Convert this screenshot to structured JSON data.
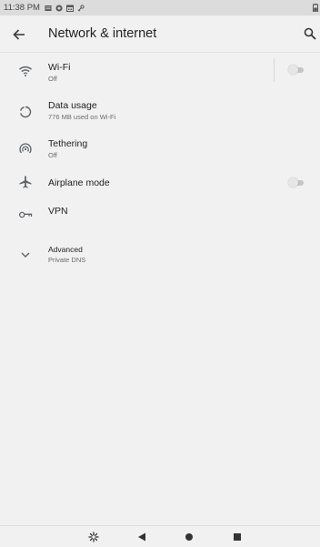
{
  "status_bar": {
    "time": "11:38 PM",
    "icons": [
      "message-icon",
      "shield-icon",
      "calendar-icon",
      "key-icon"
    ],
    "battery_icon": "battery-icon"
  },
  "app_bar": {
    "title": "Network & internet",
    "back_icon": "back-arrow-icon",
    "search_icon": "search-icon"
  },
  "items": [
    {
      "id": "wifi",
      "icon": "wifi-icon",
      "title": "Wi-Fi",
      "subtitle": "Off",
      "toggle": "off"
    },
    {
      "id": "data-usage",
      "icon": "data-usage-icon",
      "title": "Data usage",
      "subtitle": "776 MB used on Wi-Fi"
    },
    {
      "id": "tethering",
      "icon": "hotspot-icon",
      "title": "Tethering",
      "subtitle": "Off"
    },
    {
      "id": "airplane-mode",
      "icon": "airplane-icon",
      "title": "Airplane mode",
      "toggle": "off"
    },
    {
      "id": "vpn",
      "icon": "vpn-key-icon",
      "title": "VPN"
    },
    {
      "id": "advanced",
      "icon": "chevron-down-icon",
      "title": "Advanced",
      "subtitle": "Private DNS"
    }
  ],
  "nav_bar": {
    "buttons": [
      "app-switch-icon",
      "back-triangle-icon",
      "home-circle-icon",
      "recents-square-icon"
    ]
  },
  "colors": {
    "background": "#f1f1f1",
    "status_bar": "#dcdcdc",
    "icon": "#5f6368",
    "subtitle": "#6b6b6b",
    "toggle_track_off": "#c5c5c5"
  }
}
